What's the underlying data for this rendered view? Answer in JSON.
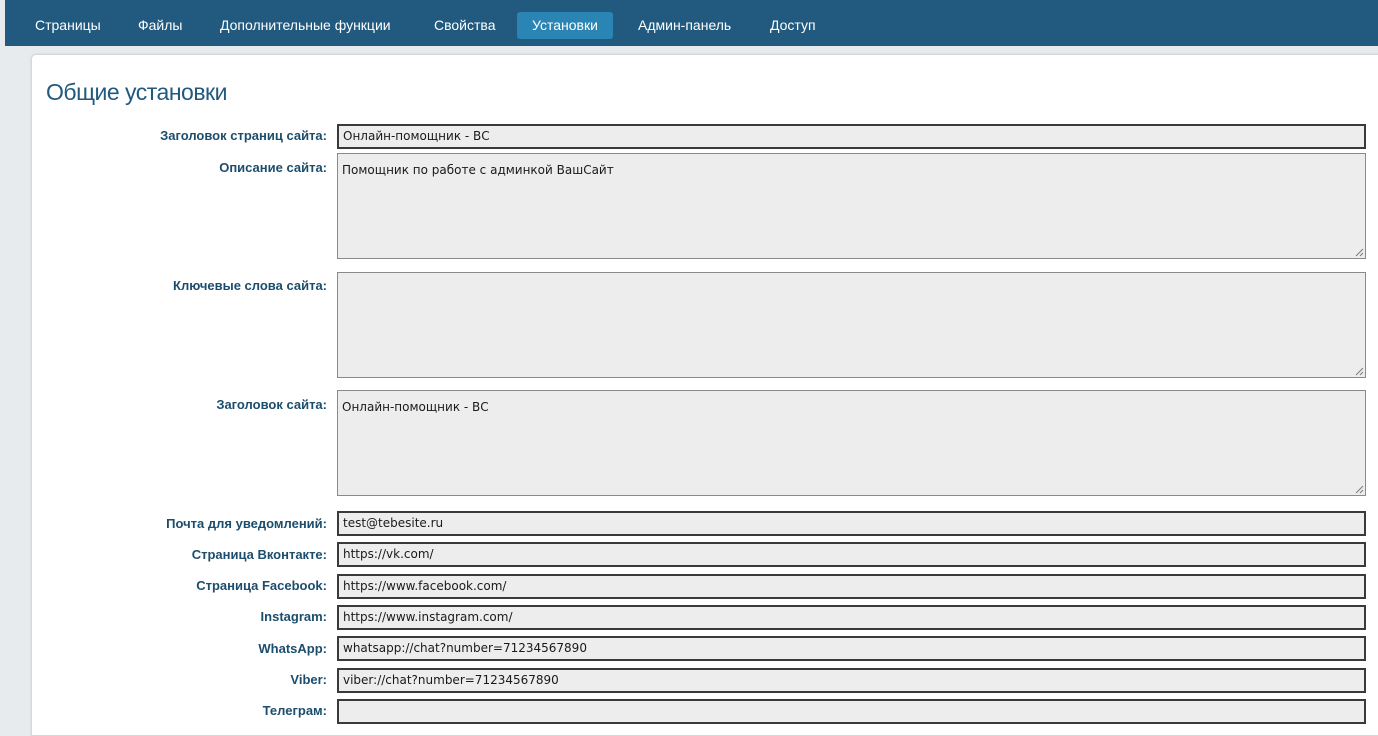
{
  "nav": {
    "items": [
      {
        "label": "Страницы"
      },
      {
        "label": "Файлы"
      },
      {
        "label": "Дополнительные функции"
      },
      {
        "label": "Свойства"
      },
      {
        "label": "Установки"
      },
      {
        "label": "Админ-панель"
      },
      {
        "label": "Доступ"
      }
    ],
    "active": "Установки",
    "bar_color": "#215a7e",
    "active_color": "#2a85b5"
  },
  "section": {
    "title": "Общие установки"
  },
  "form": {
    "fields": [
      {
        "label": "Заголовок страниц сайта:",
        "value": "Онлайн-помощник - ВС",
        "kind": "input"
      },
      {
        "label": "Описание сайта:",
        "value": "Помощник по работе с админкой ВашСайт",
        "kind": "textarea"
      },
      {
        "label": "Ключевые слова сайта:",
        "value": "",
        "kind": "textarea"
      },
      {
        "label": "Заголовок сайта:",
        "value": "Онлайн-помощник - ВС",
        "kind": "textarea"
      },
      {
        "label": "Почта для уведомлений:",
        "value": "test@tebesite.ru",
        "kind": "input"
      },
      {
        "label": "Страница Вконтакте:",
        "value": "https://vk.com/",
        "kind": "input"
      },
      {
        "label": "Страница Facebook:",
        "value": "https://www.facebook.com/",
        "kind": "input"
      },
      {
        "label": "Instagram:",
        "value": "https://www.instagram.com/",
        "kind": "input"
      },
      {
        "label": "WhatsApp:",
        "value": "whatsapp://chat?number=71234567890",
        "kind": "input"
      },
      {
        "label": "Viber:",
        "value": "viber://chat?number=71234567890",
        "kind": "input"
      },
      {
        "label": "Телеграм:",
        "value": "",
        "kind": "input"
      }
    ]
  },
  "icons": {
    "resize_grip": "resize-grip-icon"
  }
}
